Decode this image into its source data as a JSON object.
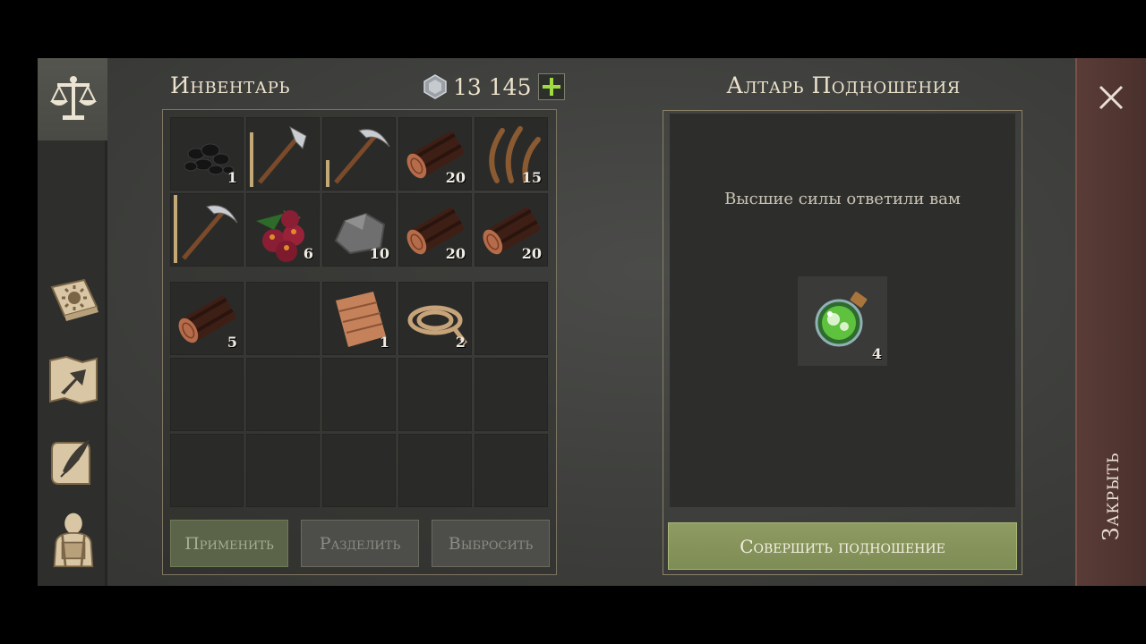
{
  "inventory": {
    "title": "Инвентарь",
    "currency": {
      "amount": "13 145",
      "icon": "silver-gem-icon",
      "add_icon": "plus-icon"
    },
    "rows": [
      [
        {
          "item": "coal-icon",
          "count": "1"
        },
        {
          "item": "hatchet-icon",
          "count": "",
          "durability": 0.8
        },
        {
          "item": "pickaxe-icon",
          "count": "",
          "durability": 0.4
        },
        {
          "item": "log-icon",
          "count": "20"
        },
        {
          "item": "plant-fiber-icon",
          "count": "15"
        }
      ],
      [
        {
          "item": "pickaxe-icon",
          "count": "",
          "durability": 1.0
        },
        {
          "item": "berries-icon",
          "count": "6"
        },
        {
          "item": "stone-icon",
          "count": "10"
        },
        {
          "item": "log-icon",
          "count": "20"
        },
        {
          "item": "log-icon",
          "count": "20"
        }
      ],
      [
        {
          "item": "log-icon",
          "count": "5"
        },
        {
          "item": "",
          "count": ""
        },
        {
          "item": "cloth-icon",
          "count": "1"
        },
        {
          "item": "rope-icon",
          "count": "2"
        },
        {
          "item": "",
          "count": ""
        }
      ],
      [
        {
          "item": "",
          "count": ""
        },
        {
          "item": "",
          "count": ""
        },
        {
          "item": "",
          "count": ""
        },
        {
          "item": "",
          "count": ""
        },
        {
          "item": "",
          "count": ""
        }
      ],
      [
        {
          "item": "",
          "count": ""
        },
        {
          "item": "",
          "count": ""
        },
        {
          "item": "",
          "count": ""
        },
        {
          "item": "",
          "count": ""
        },
        {
          "item": "",
          "count": ""
        }
      ]
    ],
    "buttons": {
      "apply": "Применить",
      "split": "Разделить",
      "drop": "Выбросить"
    }
  },
  "sidebar": {
    "items": [
      "scales-icon",
      "sun-book-icon",
      "map-arrow-icon",
      "scroll-quill-icon",
      "backpack-character-icon"
    ]
  },
  "altar": {
    "title": "Алтарь Подношения",
    "message": "Высшие силы ответили вам",
    "reward": {
      "item": "green-potion-icon",
      "count": "4"
    },
    "offer_button": "Совершить подношение"
  },
  "close": {
    "label": "Закрыть",
    "icon": "close-x-icon"
  },
  "colors": {
    "accent_green": "#8e9c63",
    "close_red": "#5a3c37",
    "frame_gold": "#8a8068"
  }
}
